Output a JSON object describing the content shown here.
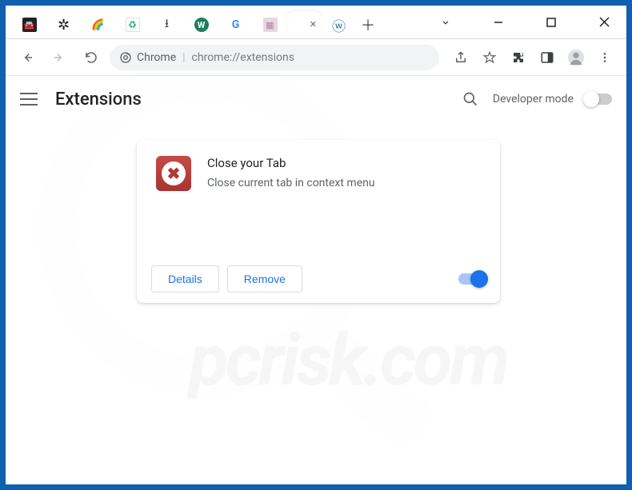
{
  "window": {
    "controls": {
      "chevron": "⌄",
      "minimize": "—",
      "maximize": "▢",
      "close": "✕"
    }
  },
  "tabs": {
    "items": [
      {
        "icon": "car-icon",
        "glyph": "🚗",
        "bg": "#222",
        "fg": "#fff"
      },
      {
        "icon": "film-icon",
        "glyph": "✱",
        "bg": "#222",
        "fg": "#fff"
      },
      {
        "icon": "rainbow-icon",
        "glyph": "🌈",
        "bg": "#fff",
        "fg": "#333"
      },
      {
        "icon": "recycle-icon",
        "glyph": "♻",
        "bg": "#fff",
        "fg": "#2a7"
      },
      {
        "icon": "download-icon",
        "glyph": "⬇",
        "bg": "#fff",
        "fg": "#333"
      },
      {
        "icon": "w-icon",
        "glyph": "W",
        "bg": "#1a7f5a",
        "fg": "#fff"
      },
      {
        "icon": "google-icon",
        "glyph": "G",
        "bg": "#fff",
        "fg": "#4285f4"
      },
      {
        "icon": "robot-icon",
        "glyph": "▦",
        "bg": "#e9d6e2",
        "fg": "#999"
      },
      {
        "icon": "extensions-tab",
        "glyph": "",
        "bg": "#fff",
        "fg": "#333",
        "active": true,
        "close": "✕"
      },
      {
        "icon": "wordpress-icon",
        "glyph": "ⓦ",
        "bg": "#fff",
        "fg": "#21759b"
      }
    ],
    "newtab_glyph": "＋"
  },
  "addrbar": {
    "chip_label": "Chrome",
    "url_rest": "chrome://extensions"
  },
  "toolbar_icons": {
    "share": "share-icon",
    "bookmark": "star-icon",
    "extensions": "puzzle-icon",
    "sidepanel": "panel-icon",
    "profile": "profile-icon",
    "menu": "menu-dots-icon"
  },
  "page": {
    "title": "Extensions",
    "developer_mode_label": "Developer mode"
  },
  "extension": {
    "name": "Close your Tab",
    "description": "Close current tab in context menu",
    "details_label": "Details",
    "remove_label": "Remove",
    "enabled": true
  },
  "watermark": "pcrisk.com"
}
